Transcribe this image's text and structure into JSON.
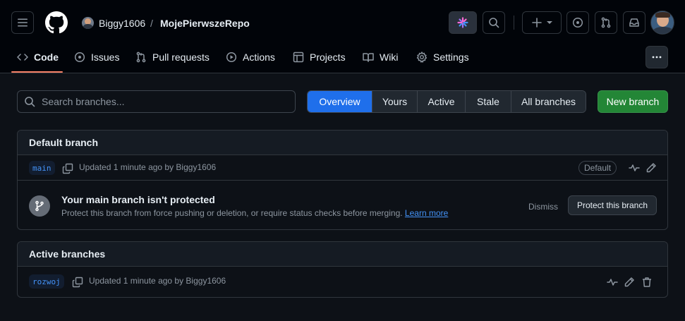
{
  "header": {
    "owner": "Biggy1606",
    "separator": "/",
    "repo": "MojePierwszeRepo"
  },
  "nav": {
    "tabs": [
      {
        "label": "Code",
        "icon": "code-icon"
      },
      {
        "label": "Issues",
        "icon": "issue-icon"
      },
      {
        "label": "Pull requests",
        "icon": "pull-request-icon"
      },
      {
        "label": "Actions",
        "icon": "play-icon"
      },
      {
        "label": "Projects",
        "icon": "table-icon"
      },
      {
        "label": "Wiki",
        "icon": "book-icon"
      },
      {
        "label": "Settings",
        "icon": "gear-icon"
      }
    ],
    "selected": "Code"
  },
  "toolbar": {
    "search_placeholder": "Search branches...",
    "filters": [
      "Overview",
      "Yours",
      "Active",
      "Stale",
      "All branches"
    ],
    "selected_filter": "Overview",
    "new_branch_label": "New branch"
  },
  "default_branch": {
    "heading": "Default branch",
    "name": "main",
    "updated": "Updated 1 minute ago by Biggy1606",
    "badge": "Default",
    "protection": {
      "title": "Your main branch isn't protected",
      "description": "Protect this branch from force pushing or deletion, or require status checks before merging.",
      "learn_more": "Learn more",
      "dismiss": "Dismiss",
      "protect_button": "Protect this branch"
    }
  },
  "active_branches": {
    "heading": "Active branches",
    "items": [
      {
        "name": "rozwoj",
        "updated": "Updated 1 minute ago by Biggy1606"
      }
    ]
  },
  "colors": {
    "accent": "#1f6feb",
    "primary_button": "#238636",
    "tab_underline": "#f78166",
    "link": "#4493f8"
  }
}
